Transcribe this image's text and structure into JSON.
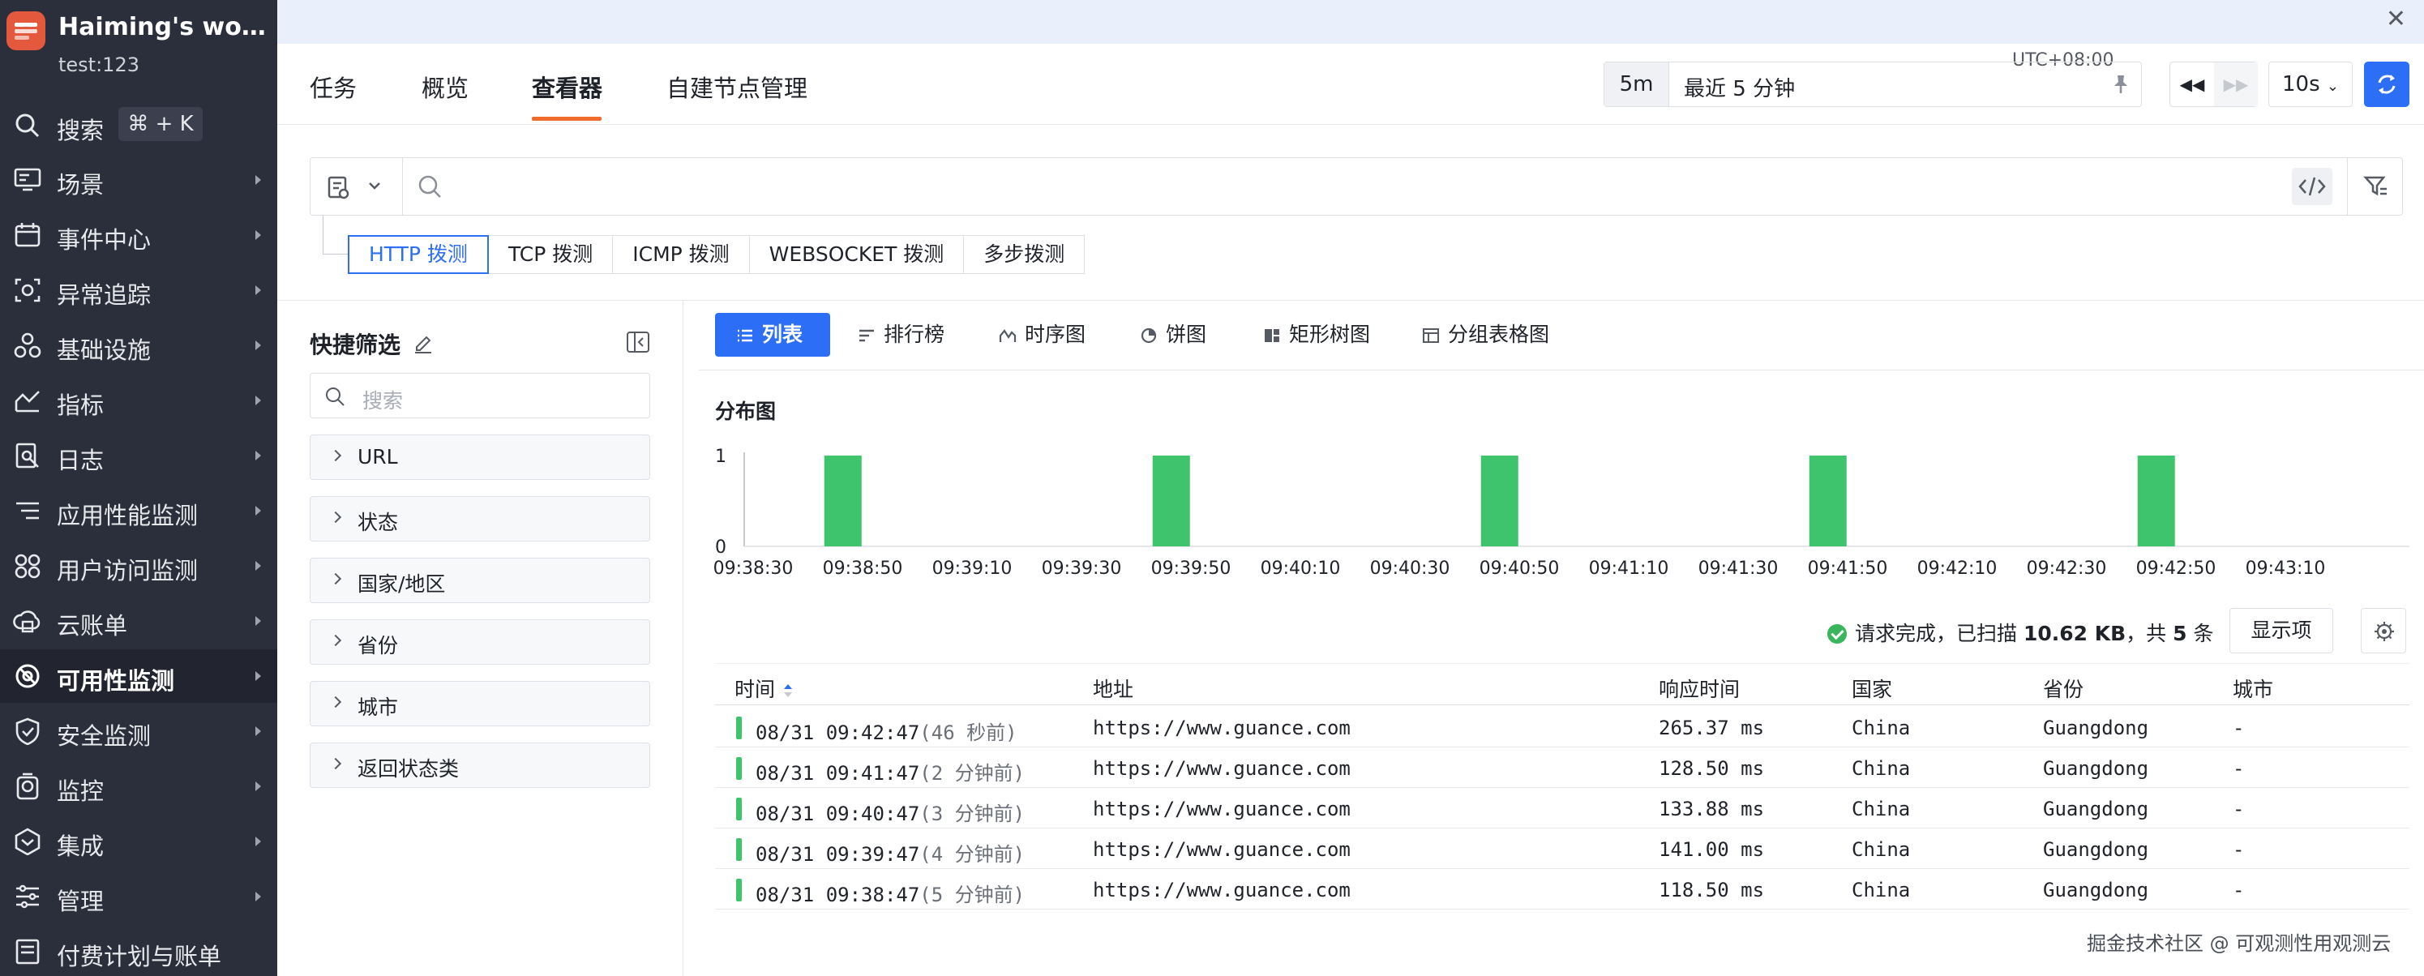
{
  "workspace": {
    "name": "Haiming's work...",
    "user": "test:123"
  },
  "sidebar": {
    "search_label": "搜索",
    "search_shortcut": "⌘ + K",
    "items": [
      {
        "label": "场景"
      },
      {
        "label": "事件中心"
      },
      {
        "label": "异常追踪"
      },
      {
        "label": "基础设施"
      },
      {
        "label": "指标"
      },
      {
        "label": "日志"
      },
      {
        "label": "应用性能监测"
      },
      {
        "label": "用户访问监测"
      },
      {
        "label": "云账单"
      },
      {
        "label": "可用性监测"
      },
      {
        "label": "安全监测"
      },
      {
        "label": "监控"
      },
      {
        "label": "集成"
      },
      {
        "label": "管理"
      },
      {
        "label": "付费计划与账单"
      }
    ],
    "active_label": "可用性监测"
  },
  "tabs": [
    "任务",
    "概览",
    "查看器",
    "自建节点管理"
  ],
  "active_tab": "查看器",
  "time": {
    "timezone": "UTC+08:00",
    "short": "5m",
    "range": "最近 5 分钟",
    "refresh_interval": "10s"
  },
  "probe_tabs": [
    "HTTP 拨测",
    "TCP 拨测",
    "ICMP 拨测",
    "WEBSOCKET 拨测",
    "多步拨测"
  ],
  "active_probe_tab": "HTTP 拨测",
  "quick_filter": {
    "title": "快捷筛选",
    "search_placeholder": "搜索",
    "facets": [
      "URL",
      "状态",
      "国家/地区",
      "省份",
      "城市",
      "返回状态类"
    ]
  },
  "view_tabs": [
    "列表",
    "排行榜",
    "时序图",
    "饼图",
    "矩形树图",
    "分组表格图"
  ],
  "active_view": "列表",
  "chart_data": {
    "type": "bar",
    "title": "分布图",
    "x_tick_labels": [
      "09:38:30",
      "09:38:50",
      "09:39:10",
      "09:39:30",
      "09:39:50",
      "09:40:10",
      "09:40:30",
      "09:40:50",
      "09:41:10",
      "09:41:30",
      "09:41:50",
      "09:42:10",
      "09:42:30",
      "09:42:50",
      "09:43:10"
    ],
    "x": [
      "09:38:47",
      "09:39:47",
      "09:40:47",
      "09:41:47",
      "09:42:47"
    ],
    "values": [
      1,
      1,
      1,
      1,
      1
    ],
    "y_ticks": [
      0,
      1
    ],
    "ylim": [
      0,
      1
    ],
    "bar_color": "#3fc46e",
    "grid": false
  },
  "status": {
    "prefix": "请求完成，已扫描 ",
    "scanned": "10.62 KB",
    "mid": "，共 ",
    "count": "5",
    "suffix": " 条"
  },
  "show_columns_label": "显示项",
  "table": {
    "headers": [
      "时间",
      "地址",
      "响应时间",
      "国家",
      "省份",
      "城市"
    ],
    "rows": [
      {
        "time": "08/31 09:42:47",
        "ago": "(46 秒前)",
        "url": "https://www.guance.com",
        "resp": "265.37 ms",
        "country": "China",
        "province": "Guangdong",
        "city": "-"
      },
      {
        "time": "08/31 09:41:47",
        "ago": "(2 分钟前)",
        "url": "https://www.guance.com",
        "resp": "128.50 ms",
        "country": "China",
        "province": "Guangdong",
        "city": "-"
      },
      {
        "time": "08/31 09:40:47",
        "ago": "(3 分钟前)",
        "url": "https://www.guance.com",
        "resp": "133.88 ms",
        "country": "China",
        "province": "Guangdong",
        "city": "-"
      },
      {
        "time": "08/31 09:39:47",
        "ago": "(4 分钟前)",
        "url": "https://www.guance.com",
        "resp": "141.00 ms",
        "country": "China",
        "province": "Guangdong",
        "city": "-"
      },
      {
        "time": "08/31 09:38:47",
        "ago": "(5 分钟前)",
        "url": "https://www.guance.com",
        "resp": "118.50 ms",
        "country": "China",
        "province": "Guangdong",
        "city": "-"
      }
    ]
  },
  "watermark": "掘金技术社区 @ 可观测性用观测云",
  "colors": {
    "sidebar_bg": "#2b2e3b",
    "accent": "#2c6ef5",
    "tab_underline": "#ef6c2d",
    "ok": "#39b55b"
  }
}
